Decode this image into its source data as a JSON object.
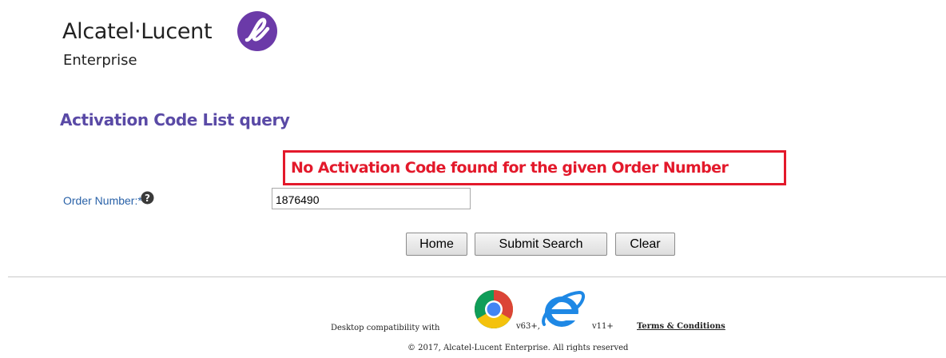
{
  "brand": {
    "name": "Alcatel·Lucent",
    "sub": "Enterprise",
    "mark_color": "#6b3aa8"
  },
  "page": {
    "title": "Activation Code List query"
  },
  "message": {
    "error": "No Activation Code found for the given Order Number",
    "color": "#e3192b"
  },
  "form": {
    "order_label": "Order Number:*",
    "order_value": "1876490",
    "help_icon": "question-circle-icon"
  },
  "buttons": {
    "home": "Home",
    "submit": "Submit Search",
    "clear": "Clear"
  },
  "footer": {
    "compat_prefix": "Desktop compatibility with",
    "chrome_icon": "chrome-icon",
    "chrome_version": "v63+,",
    "ie_icon": "internet-explorer-icon",
    "ie_version": "v11+",
    "terms": "Terms & Conditions",
    "copyright": "© 2017, Alcatel-Lucent Enterprise. All rights reserved"
  }
}
